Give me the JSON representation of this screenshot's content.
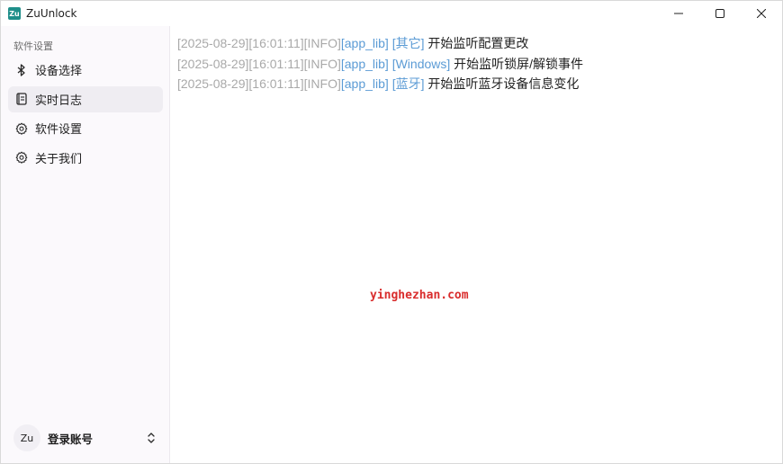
{
  "window": {
    "app_logo_text": "Zu",
    "title": "ZuUnlock"
  },
  "sidebar": {
    "section_label": "软件设置",
    "items": [
      {
        "label": "设备选择",
        "icon": "bluetooth-icon",
        "active": false
      },
      {
        "label": "实时日志",
        "icon": "log-book-icon",
        "active": true
      },
      {
        "label": "软件设置",
        "icon": "gear-icon",
        "active": false
      },
      {
        "label": "关于我们",
        "icon": "gear-icon",
        "active": false
      }
    ],
    "account": {
      "avatar_text": "Zu",
      "label": "登录账号"
    }
  },
  "log": {
    "lines": [
      {
        "timestamp": "[2025-08-29][16:01:11]",
        "level": "[INFO]",
        "lib": "[app_lib]",
        "tag": "[其它]",
        "message": "开始监听配置更改"
      },
      {
        "timestamp": "[2025-08-29][16:01:11]",
        "level": "[INFO]",
        "lib": "[app_lib]",
        "tag": "[Windows]",
        "message": "开始监听锁屏/解锁事件"
      },
      {
        "timestamp": "[2025-08-29][16:01:11]",
        "level": "[INFO]",
        "lib": "[app_lib]",
        "tag": "[蓝牙]",
        "message": "开始监听蓝牙设备信息变化"
      }
    ]
  },
  "watermark": "yinghezhan.com",
  "colors": {
    "accent_tag": "#5b9bd5",
    "timestamp": "#a9a9a9",
    "sidebar_bg": "#fbf9fc",
    "active_item_bg": "#efedf2",
    "logo_bg": "#1f8f8a",
    "watermark": "#d92c2c"
  }
}
